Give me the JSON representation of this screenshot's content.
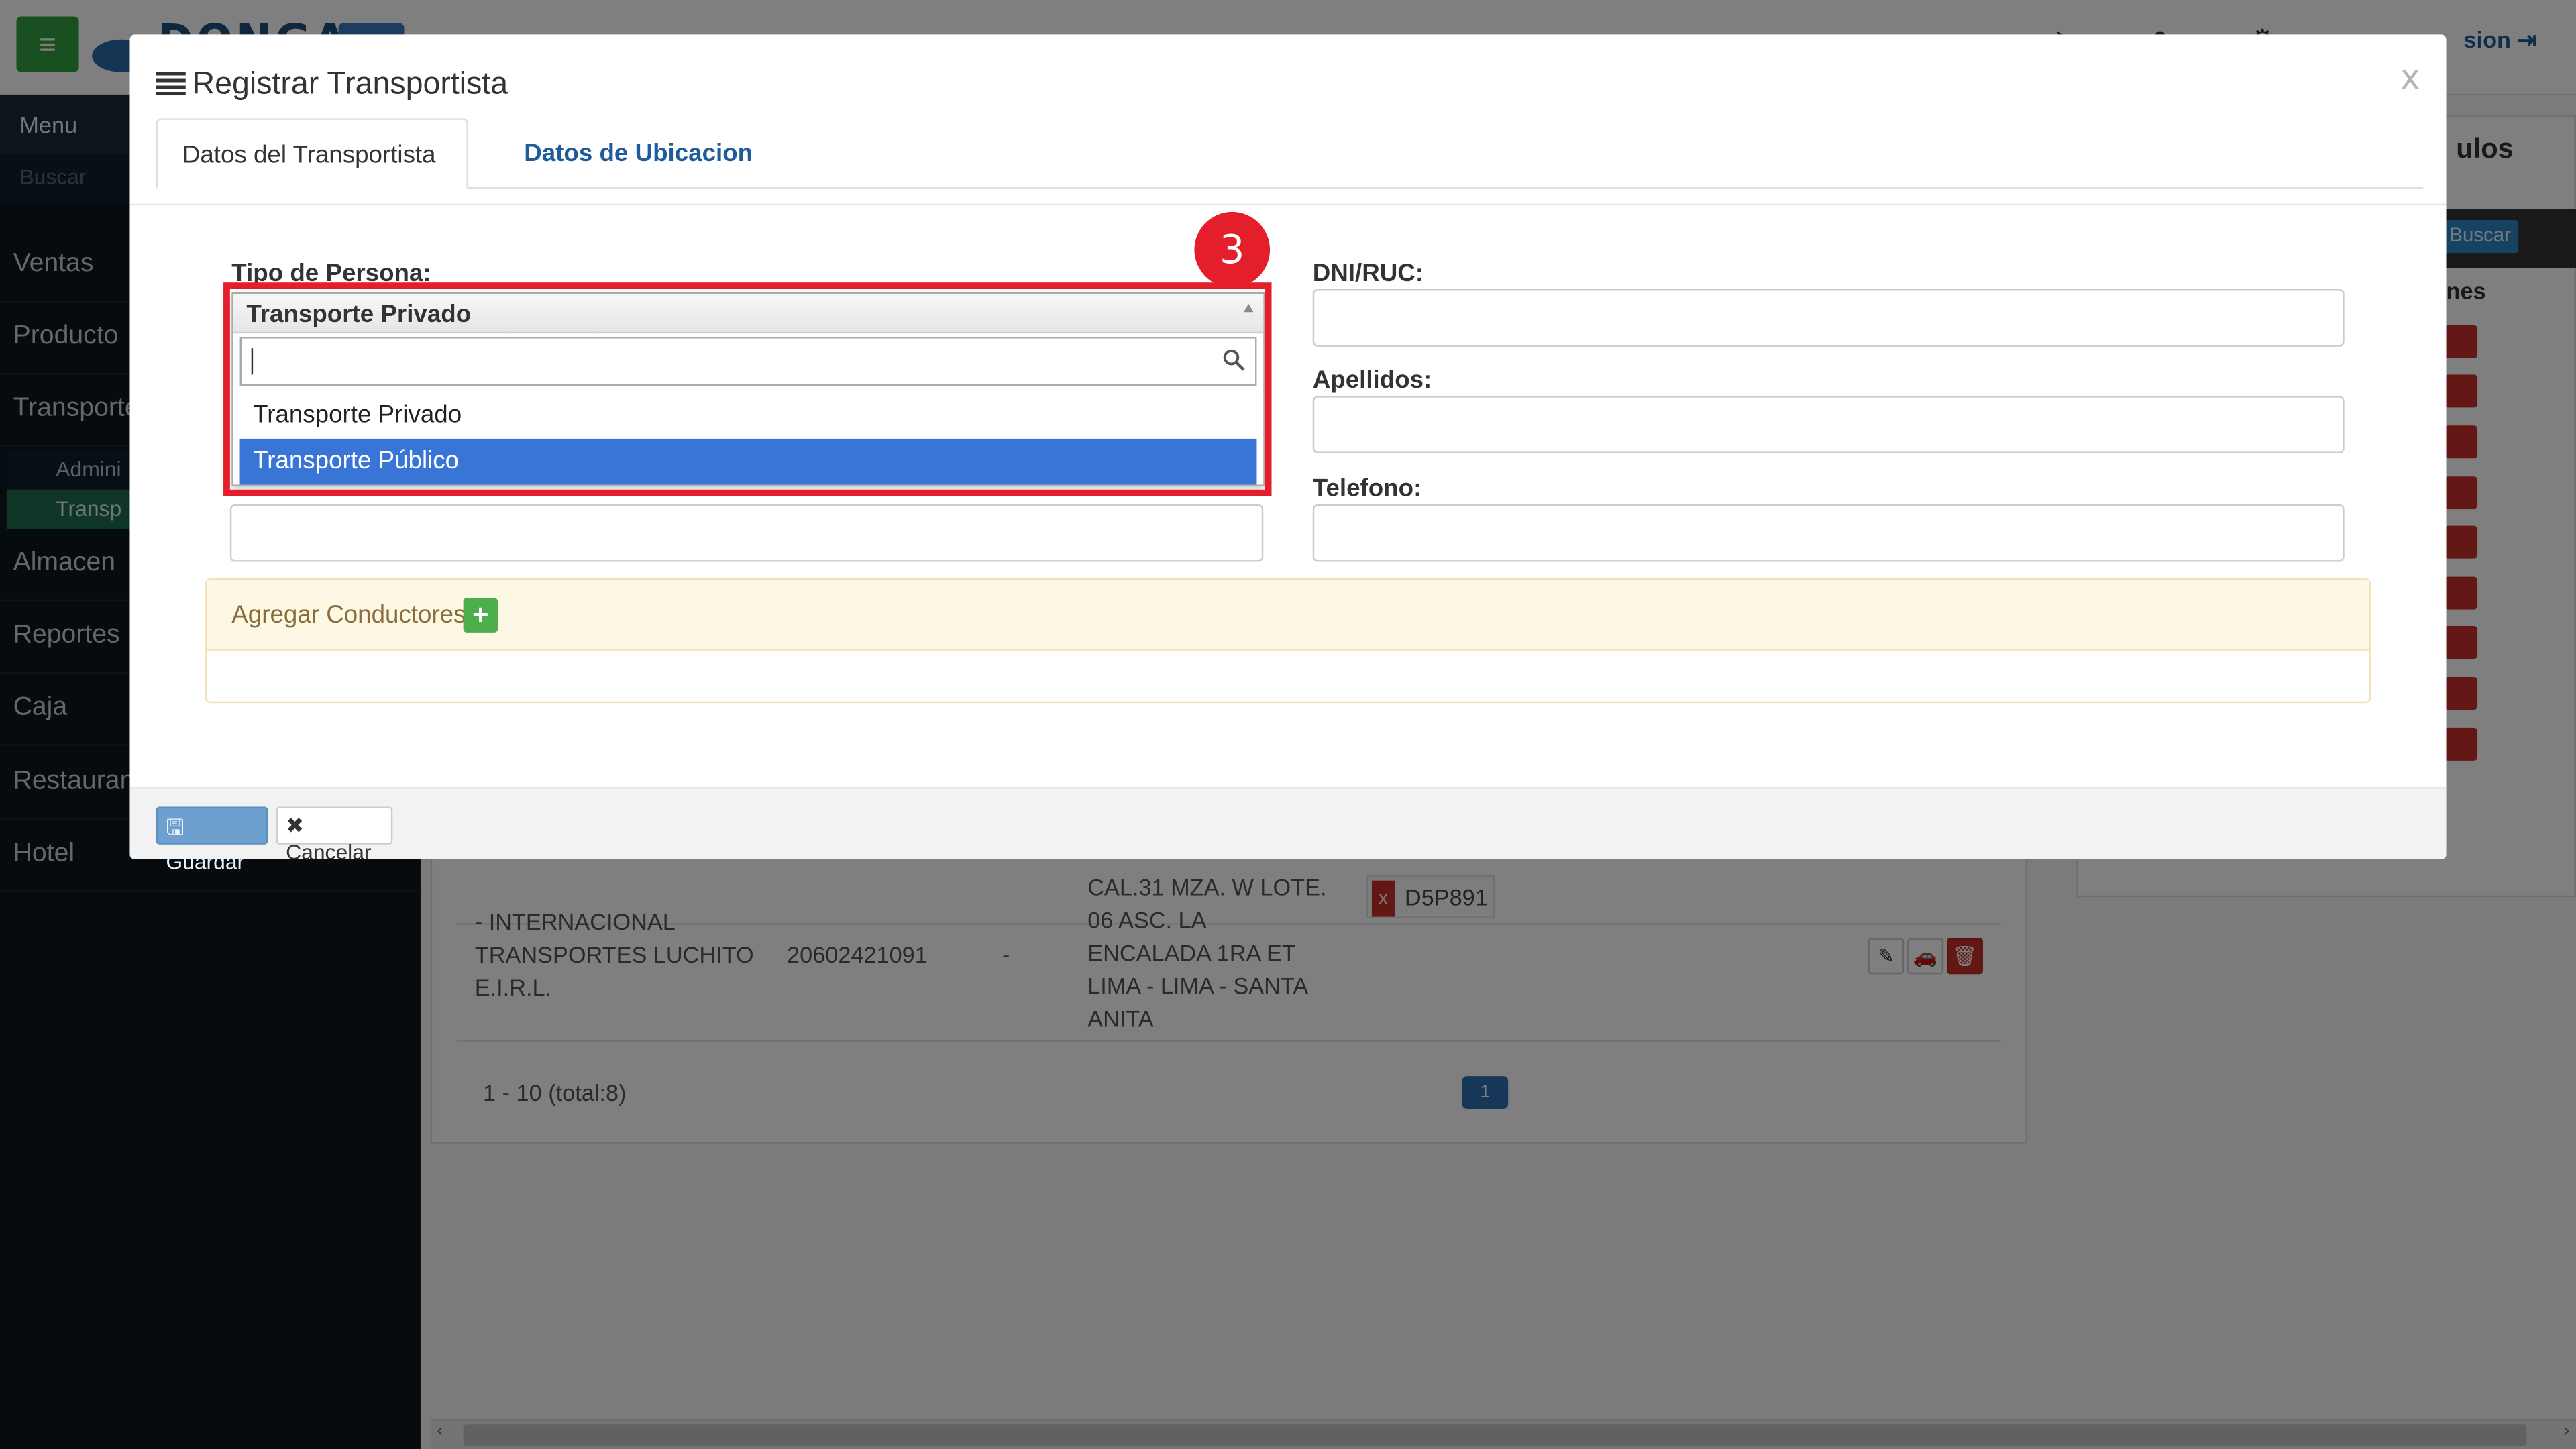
{
  "app": {
    "logo_text": "DONGA",
    "logout_label": "sion",
    "colors": {
      "primary": "#1f5c99",
      "success": "#4cae4c",
      "danger": "#c9302c",
      "highlight": "#e41e2a",
      "select_hl": "#3875d7"
    }
  },
  "sidebar": {
    "menu_label": "Menu",
    "search_placeholder": "Buscar",
    "items": [
      "Ventas",
      "Producto",
      "Transporte",
      "Almacen",
      "Reportes",
      "Caja",
      "Restaurant",
      "Hotel"
    ],
    "subitems": [
      "Admini",
      "Transp"
    ]
  },
  "background": {
    "right_panel": {
      "title": "ulos",
      "search_button": "Buscar",
      "column": "nes"
    },
    "row": {
      "name": "- INTERNACIONAL TRANSPORTES LUCHITO E.I.R.L.",
      "ruc": "20602421091",
      "dash": "-",
      "address": "CAL.31 MZA. W LOTE. 06 ASC. LA ENCALADA 1RA ET LIMA - LIMA - SANTA ANITA",
      "plate": "D5P891"
    },
    "pager": {
      "summary": "1 - 10 (total:8)",
      "page": "1"
    }
  },
  "modal": {
    "title": "Registrar Transportista",
    "close": "x",
    "tabs": [
      "Datos del Transportista",
      "Datos de Ubicacion"
    ],
    "fields": {
      "tipo_label": "Tipo de Persona:",
      "dni_label": "DNI/RUC:",
      "apellidos_label": "Apellidos:",
      "telefono_label": "Telefono:"
    },
    "select": {
      "selected": "Transporte Privado",
      "search_value": "",
      "options": [
        "Transporte Privado",
        "Transporte Público"
      ],
      "highlighted_index": 1
    },
    "conductores_label": "Agregar Conductores",
    "plus": "+",
    "footer": {
      "save": "Guardar",
      "cancel": "Cancelar"
    }
  },
  "annotation": {
    "step": "3"
  }
}
